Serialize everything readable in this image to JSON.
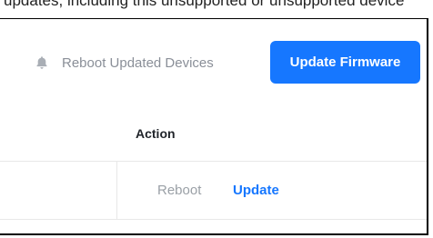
{
  "top_strip": {
    "cut_text": "updates, including this unsupported or unsupported device"
  },
  "toolbar": {
    "reboot_updated_label": "Reboot Updated Devices",
    "update_firmware_label": "Update Firmware"
  },
  "table": {
    "columns": [
      "Action"
    ],
    "rows": [
      {
        "actions": [
          "Reboot",
          "Update"
        ]
      }
    ]
  },
  "colors": {
    "primary": "#1677ff",
    "muted_text": "#8a8f98",
    "divider": "#e8e8e8"
  },
  "icons": {
    "reboot_updated_icon": "bell-icon"
  }
}
